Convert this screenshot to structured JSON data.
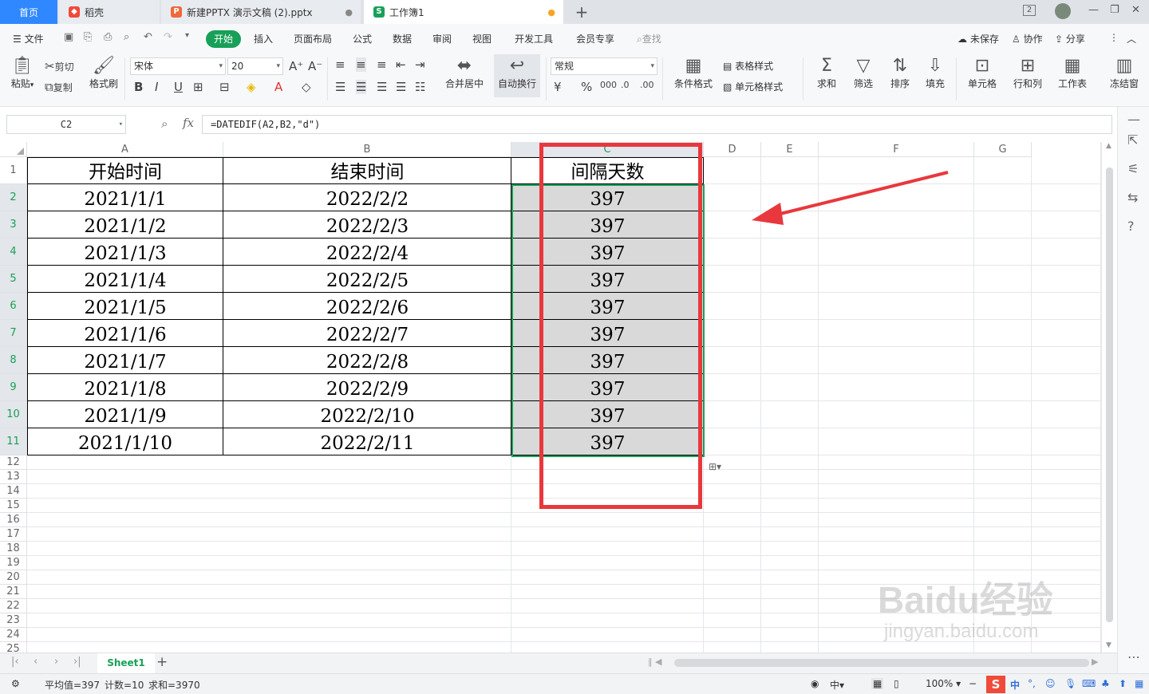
{
  "tabs": {
    "home": "首页",
    "daoke": "稻壳",
    "pptx": "新建PPTX 演示文稿 (2).pptx",
    "book": "工作簿1",
    "add": "+",
    "pptx_icon": "P",
    "book_icon": "S",
    "badge": "2"
  },
  "menu": {
    "file": "文件",
    "items": [
      "开始",
      "插入",
      "页面布局",
      "公式",
      "数据",
      "审阅",
      "视图",
      "开发工具",
      "会员专享"
    ],
    "search": "查找",
    "unsaved": "未保存",
    "collab": "协作",
    "share": "分享"
  },
  "ribbon": {
    "paste": "粘贴",
    "cut": "剪切",
    "copy": "复制",
    "format_painter": "格式刷",
    "font_name": "宋体",
    "font_size": "20",
    "merge_center": "合并居中",
    "wrap_text": "自动换行",
    "number_format": "常规",
    "cond_format": "条件格式",
    "table_style": "表格样式",
    "cell_style": "单元格样式",
    "sum": "求和",
    "filter": "筛选",
    "sort": "排序",
    "fill": "填充",
    "cell": "单元格",
    "row_col": "行和列",
    "worksheet": "工作表",
    "freeze": "冻结窗"
  },
  "formula_bar": {
    "cell_ref": "C2",
    "fx": "fx",
    "formula": "=DATEDIF(A2,B2,\"d\")"
  },
  "columns": [
    "A",
    "B",
    "C",
    "D",
    "E",
    "F",
    "G"
  ],
  "rows": [
    "1",
    "2",
    "3",
    "4",
    "5",
    "6",
    "7",
    "8",
    "9",
    "10",
    "11",
    "12",
    "13",
    "14",
    "15",
    "16",
    "17",
    "18",
    "19",
    "20",
    "21",
    "22",
    "23",
    "24",
    "25"
  ],
  "table": {
    "headers": [
      "开始时间",
      "结束时间",
      "间隔天数"
    ],
    "data": [
      [
        "2021/1/1",
        "2022/2/2",
        "397"
      ],
      [
        "2021/1/2",
        "2022/2/3",
        "397"
      ],
      [
        "2021/1/3",
        "2022/2/4",
        "397"
      ],
      [
        "2021/1/4",
        "2022/2/5",
        "397"
      ],
      [
        "2021/1/5",
        "2022/2/6",
        "397"
      ],
      [
        "2021/1/6",
        "2022/2/7",
        "397"
      ],
      [
        "2021/1/7",
        "2022/2/8",
        "397"
      ],
      [
        "2021/1/8",
        "2022/2/9",
        "397"
      ],
      [
        "2021/1/9",
        "2022/2/10",
        "397"
      ],
      [
        "2021/1/10",
        "2022/2/11",
        "397"
      ]
    ]
  },
  "sheet": {
    "name": "Sheet1",
    "add": "+"
  },
  "status": {
    "average": "平均值=397",
    "count": "计数=10",
    "sum": "求和=3970",
    "zoom": "100%"
  },
  "watermark": {
    "brand": "Baidu经验",
    "url": "jingyan.baidu.com"
  },
  "colors": {
    "accent": "#18a058",
    "highlight": "#e8383d",
    "selection_fill": "#d9d9d9",
    "tab_active": "#2f88ff"
  }
}
